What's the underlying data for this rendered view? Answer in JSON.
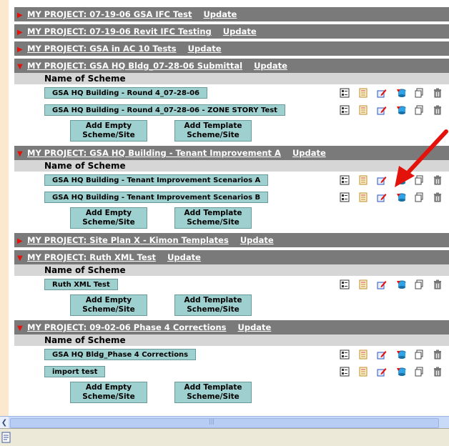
{
  "projects": [
    {
      "title": "MY PROJECT: 07-19-06 GSA IFC Test",
      "update": "Update",
      "expanded": false
    },
    {
      "title": "MY PROJECT: 07-19-06 Revit IFC Testing",
      "update": "Update",
      "expanded": false
    },
    {
      "title": "MY PROJECT: GSA in AC 10 Tests",
      "update": "Update",
      "expanded": false
    },
    {
      "title": "MY PROJECT: GSA HQ Bldg_07-28-06 Submittal",
      "update": "Update",
      "expanded": true,
      "section_label": "Name of Scheme",
      "schemes": [
        "GSA HQ Building - Round 4_07-28-06",
        "GSA HQ Building - Round 4_07-28-06 - ZONE STORY Test"
      ],
      "add_empty": [
        "Add Empty",
        "Scheme/Site"
      ],
      "add_template": [
        "Add Template",
        "Scheme/Site"
      ]
    },
    {
      "title": "MY PROJECT: GSA HQ Building - Tenant Improvement A",
      "update": "Update",
      "expanded": true,
      "section_label": "Name of Scheme",
      "schemes": [
        "GSA HQ Building - Tenant Improvement Scenarios A",
        "GSA HQ Building - Tenant Improvement Scenarios B"
      ],
      "add_empty": [
        "Add Empty",
        "Scheme/Site"
      ],
      "add_template": [
        "Add Template",
        "Scheme/Site"
      ]
    },
    {
      "title": "MY PROJECT: Site Plan X - Kimon Templates",
      "update": "Update",
      "expanded": false
    },
    {
      "title": "MY PROJECT: Ruth XML Test",
      "update": "Update",
      "expanded": true,
      "section_label": "Name of Scheme",
      "schemes": [
        "Ruth XML Test"
      ],
      "add_empty": [
        "Add Empty",
        "Scheme/Site"
      ],
      "add_template": [
        "Add Template",
        "Scheme/Site"
      ]
    },
    {
      "title": "MY PROJECT: 09-02-06  Phase 4 Corrections",
      "update": "Update",
      "expanded": true,
      "section_label": "Name of Scheme",
      "schemes": [
        "GSA HQ Bldg_Phase 4 Corrections",
        "import test"
      ],
      "add_empty": [
        "Add Empty",
        "Scheme/Site"
      ],
      "add_template": [
        "Add Template",
        "Scheme/Site"
      ]
    }
  ],
  "tool_icons": [
    "properties-icon",
    "report-icon",
    "edit-icon",
    "export-icon",
    "copy-icon",
    "delete-icon"
  ],
  "colors": {
    "header_bg": "#7a7a7a",
    "label_bg": "#d6d6d6",
    "button_bg": "#9fd0d0",
    "arrow_red": "#e3120b"
  }
}
